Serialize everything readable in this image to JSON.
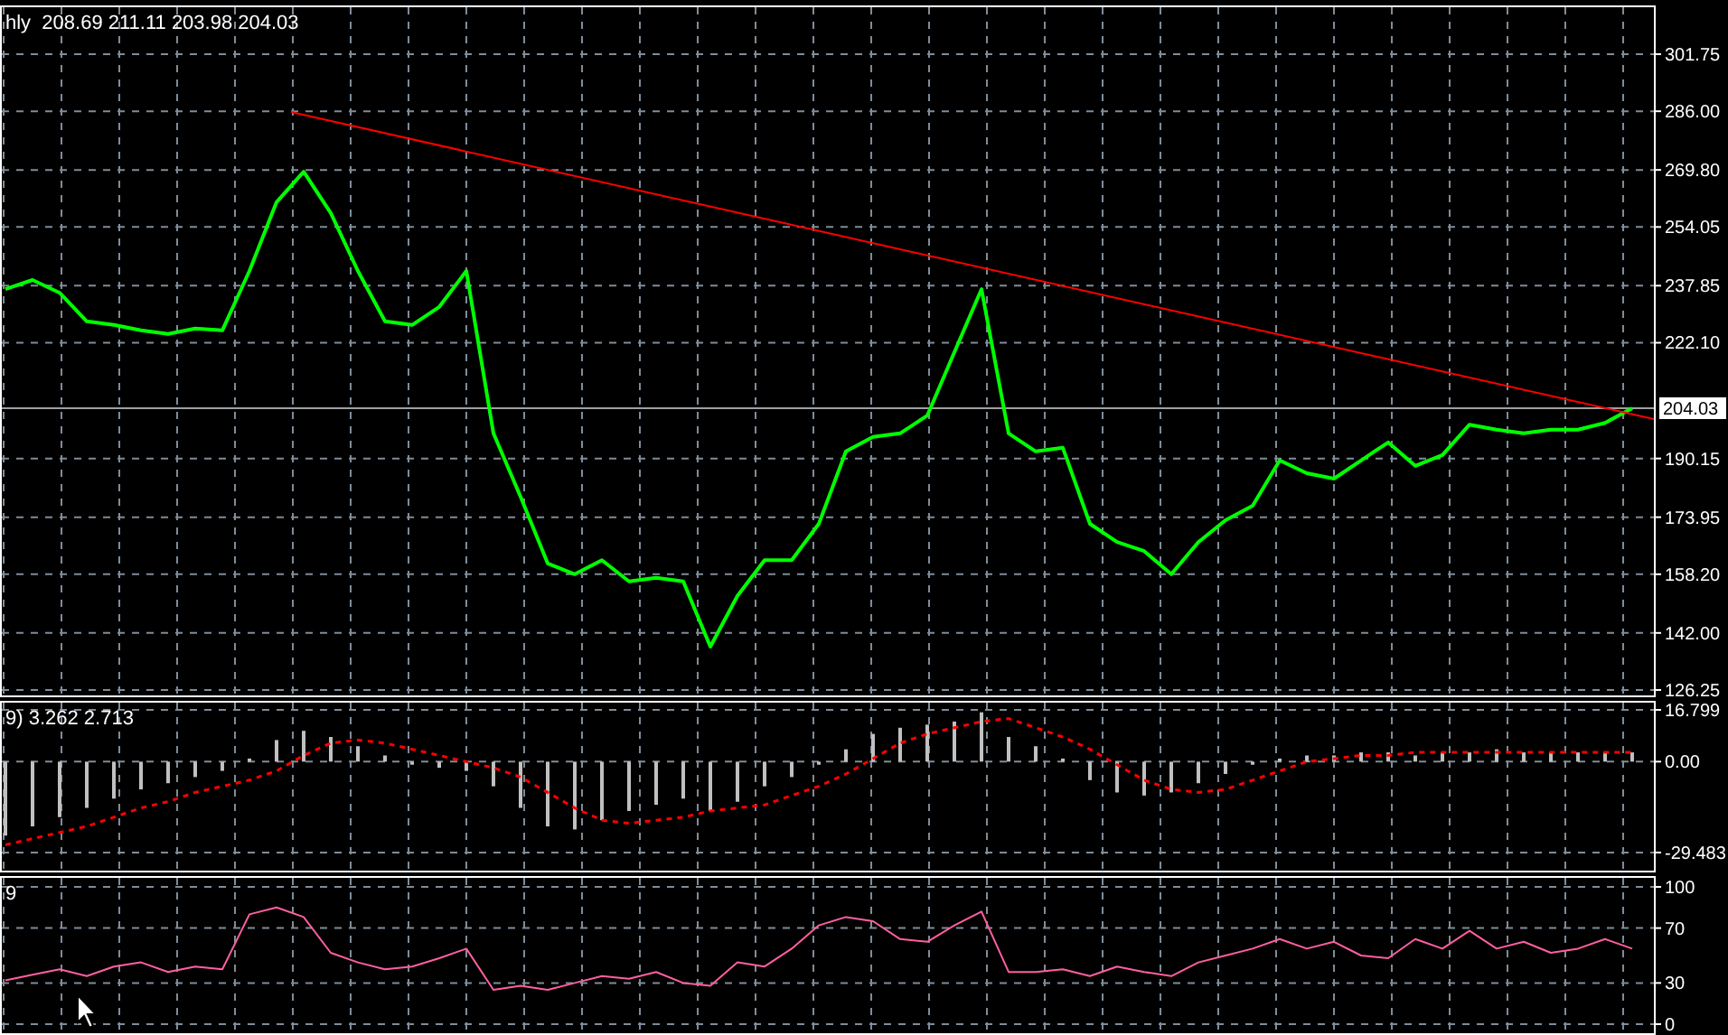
{
  "panes": [
    {
      "label": "hly  208.69 211.11 203.98 204.03",
      "price_marker": "204.03",
      "chart_data": {
        "type": "line",
        "grid": true,
        "ylim": [
          124.75,
          314.71
        ],
        "ref_lines": [
          {
            "value": 204.03,
            "axis": "y",
            "color": "#a0a0a0"
          }
        ],
        "yticks": [
          {
            "value": 301.75,
            "label": "301.75"
          },
          {
            "value": 286.0,
            "label": "286.00"
          },
          {
            "value": 269.8,
            "label": "269.80"
          },
          {
            "value": 254.05,
            "label": "254.05"
          },
          {
            "value": 237.85,
            "label": "237.85"
          },
          {
            "value": 222.1,
            "label": "222.10"
          },
          {
            "value": 190.15,
            "label": "190.15"
          },
          {
            "value": 173.95,
            "label": "173.95"
          },
          {
            "value": 158.2,
            "label": "158.20"
          },
          {
            "value": 142.0,
            "label": "142.00"
          },
          {
            "value": 126.25,
            "label": "126.25"
          }
        ],
        "series": [
          {
            "color": "#00ff00",
            "values": [
              236.9,
              239.4,
              235.9,
              228.0,
              227.0,
              225.5,
              224.5,
              226.0,
              225.5,
              241.9,
              260.9,
              269.3,
              257.9,
              241.9,
              228.0,
              227.0,
              232.0,
              241.9,
              197.1,
              179.6,
              161.2,
              158.2,
              162.1,
              156.2,
              157.2,
              156.2,
              138.2,
              152.2,
              162.1,
              162.1,
              172.1,
              192.1,
              196.1,
              197.1,
              202.0,
              219.5,
              236.9,
              197.1,
              192.1,
              193.1,
              172.1,
              167.1,
              164.6,
              158.2,
              167.1,
              173.1,
              177.1,
              189.6,
              186.1,
              184.6,
              189.6,
              194.6,
              188.1,
              191.1,
              199.5,
              198.1,
              197.1,
              198.1,
              198.1,
              200.0,
              204.0
            ]
          }
        ]
      }
    },
    {
      "label": "9) 3.262 2.713",
      "chart_data": {
        "type": "bar",
        "grid": true,
        "ylim": [
          -35.36,
          19.14
        ],
        "yticks": [
          {
            "value": 16.799,
            "label": "16.799"
          },
          {
            "value": 0,
            "label": "0.00"
          },
          {
            "value": -29.483,
            "label": "-29.483"
          }
        ],
        "series": [
          {
            "type": "bar",
            "color": "#c0c0c0",
            "values": [
              -24,
              -21,
              -18,
              -15,
              -12,
              -9,
              -7,
              -5,
              -3,
              1,
              7,
              10,
              8,
              5,
              2,
              -1,
              -2,
              -3,
              -8,
              -15,
              -21,
              -22,
              -19,
              -16,
              -14,
              -12,
              -16,
              -13,
              -8,
              -5,
              -1,
              4,
              9,
              11,
              12,
              13,
              16,
              8,
              5,
              1,
              -6,
              -10,
              -11,
              -10,
              -7,
              -4,
              -1,
              1,
              2,
              2,
              3,
              3,
              2,
              3,
              3,
              4,
              3,
              3,
              3,
              3,
              3
            ]
          },
          {
            "type": "line",
            "line_style": "dashed",
            "color": "#ff0000",
            "values": [
              -27,
              -25,
              -23,
              -21,
              -18,
              -15,
              -13,
              -10,
              -8,
              -6,
              -3,
              2,
              6,
              7,
              6,
              4,
              2,
              0,
              -2,
              -5,
              -10,
              -15,
              -19,
              -20,
              -19,
              -18,
              -16,
              -15,
              -14,
              -11,
              -8,
              -4,
              1,
              6,
              9,
              11,
              13,
              14,
              11,
              8,
              4,
              -1,
              -6,
              -9,
              -10,
              -9,
              -6,
              -3,
              0,
              1,
              2,
              2,
              3,
              3,
              3,
              3,
              3,
              3,
              3,
              3,
              3
            ]
          }
        ]
      }
    },
    {
      "label": "9",
      "chart_data": {
        "type": "line",
        "grid": true,
        "ylim": [
          -6.6,
          106.6
        ],
        "yticks": [
          {
            "value": 100,
            "label": "100"
          },
          {
            "value": 70,
            "label": "70"
          },
          {
            "value": 30,
            "label": "30"
          },
          {
            "value": 0,
            "label": "0"
          }
        ],
        "series": [
          {
            "color": "#ff5fa0",
            "values": [
              32,
              36,
              40,
              35,
              42,
              45,
              38,
              42,
              40,
              80,
              85,
              78,
              52,
              45,
              40,
              42,
              48,
              55,
              25,
              28,
              25,
              30,
              35,
              33,
              38,
              30,
              28,
              45,
              42,
              55,
              72,
              78,
              75,
              62,
              60,
              72,
              82,
              38,
              38,
              40,
              35,
              42,
              38,
              35,
              45,
              50,
              55,
              62,
              55,
              60,
              50,
              48,
              62,
              55,
              68,
              55,
              60,
              52,
              55,
              62,
              55
            ]
          }
        ]
      }
    }
  ]
}
